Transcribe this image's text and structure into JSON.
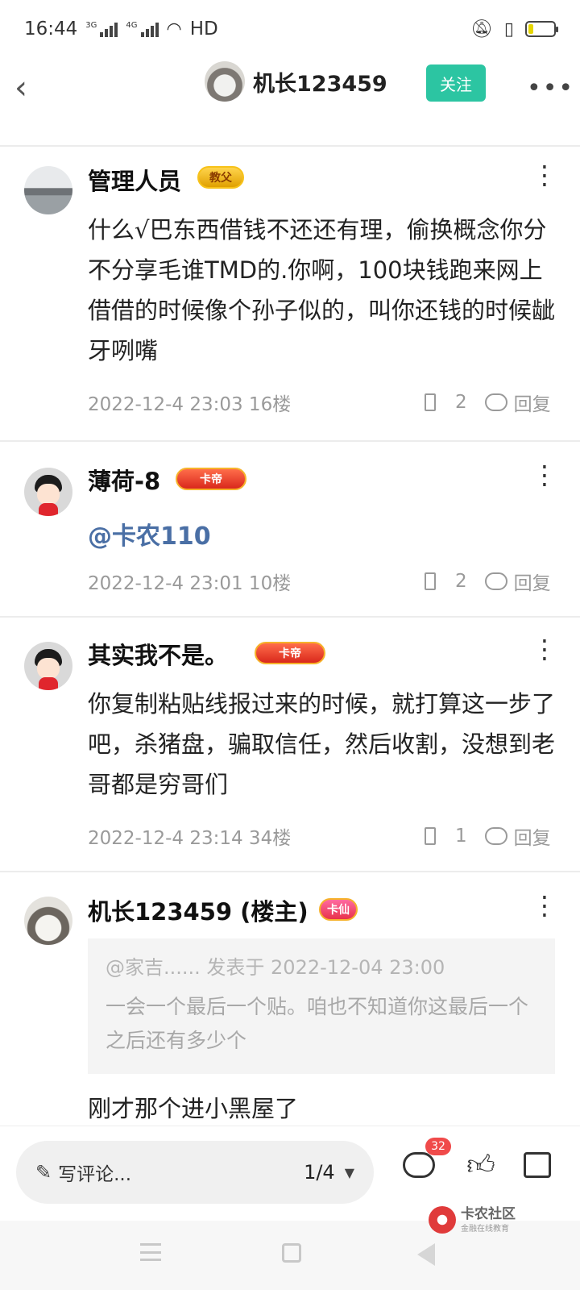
{
  "status_bar": {
    "time": "16:44",
    "network1": "3G",
    "network2": "4G",
    "wifi_label": "HD",
    "icons": [
      "signal-icon",
      "wifi-icon",
      "mute-icon",
      "vibrate-icon",
      "battery-icon"
    ]
  },
  "header": {
    "author_name": "机长123459",
    "follow_label": "关注",
    "more_label": "•••"
  },
  "comments": [
    {
      "name": "管理人员",
      "badge": "教父",
      "text": "什么√巴东西借钱不还还有理，偷换概念你分不分享毛谁TMD的.你啊，100块钱跑来网上借借的时候像个孙子似的，叫你还钱的时候龇牙咧嘴",
      "meta": "2022-12-4 23:03  16楼",
      "likes": "2",
      "reply_label": "回复"
    },
    {
      "name": "薄荷-8",
      "badge": "卡帝",
      "mention": "@卡农110",
      "meta": "2022-12-4 23:01  10楼",
      "likes": "2",
      "reply_label": "回复"
    },
    {
      "name": "其实我不是。",
      "badge": "卡帝",
      "text": "你复制粘贴线报过来的时候，就打算这一步了吧，杀猪盘，骗取信任，然后收割，没想到老哥都是穷哥们",
      "meta": "2022-12-4 23:14  34楼",
      "likes": "1",
      "reply_label": "回复"
    },
    {
      "name": "机长123459 (楼主)",
      "badge": "卡仙",
      "quote_head": "@家吉...... 发表于 2022-12-04 23:00",
      "quote_body": "一会一个最后一个贴。咱也不知道你这最后一个之后还有多少个",
      "text": "刚才那个进小黑屋了"
    }
  ],
  "bottom_bar": {
    "write_label": "写评论...",
    "page": "1/4",
    "comment_count": "32"
  },
  "watermark": {
    "title": "卡农社区",
    "subtitle": "金融在线教育"
  },
  "colors": {
    "accent": "#2cc5a2",
    "mention": "#4a6fa5",
    "badge_red": "#f04a4a"
  }
}
